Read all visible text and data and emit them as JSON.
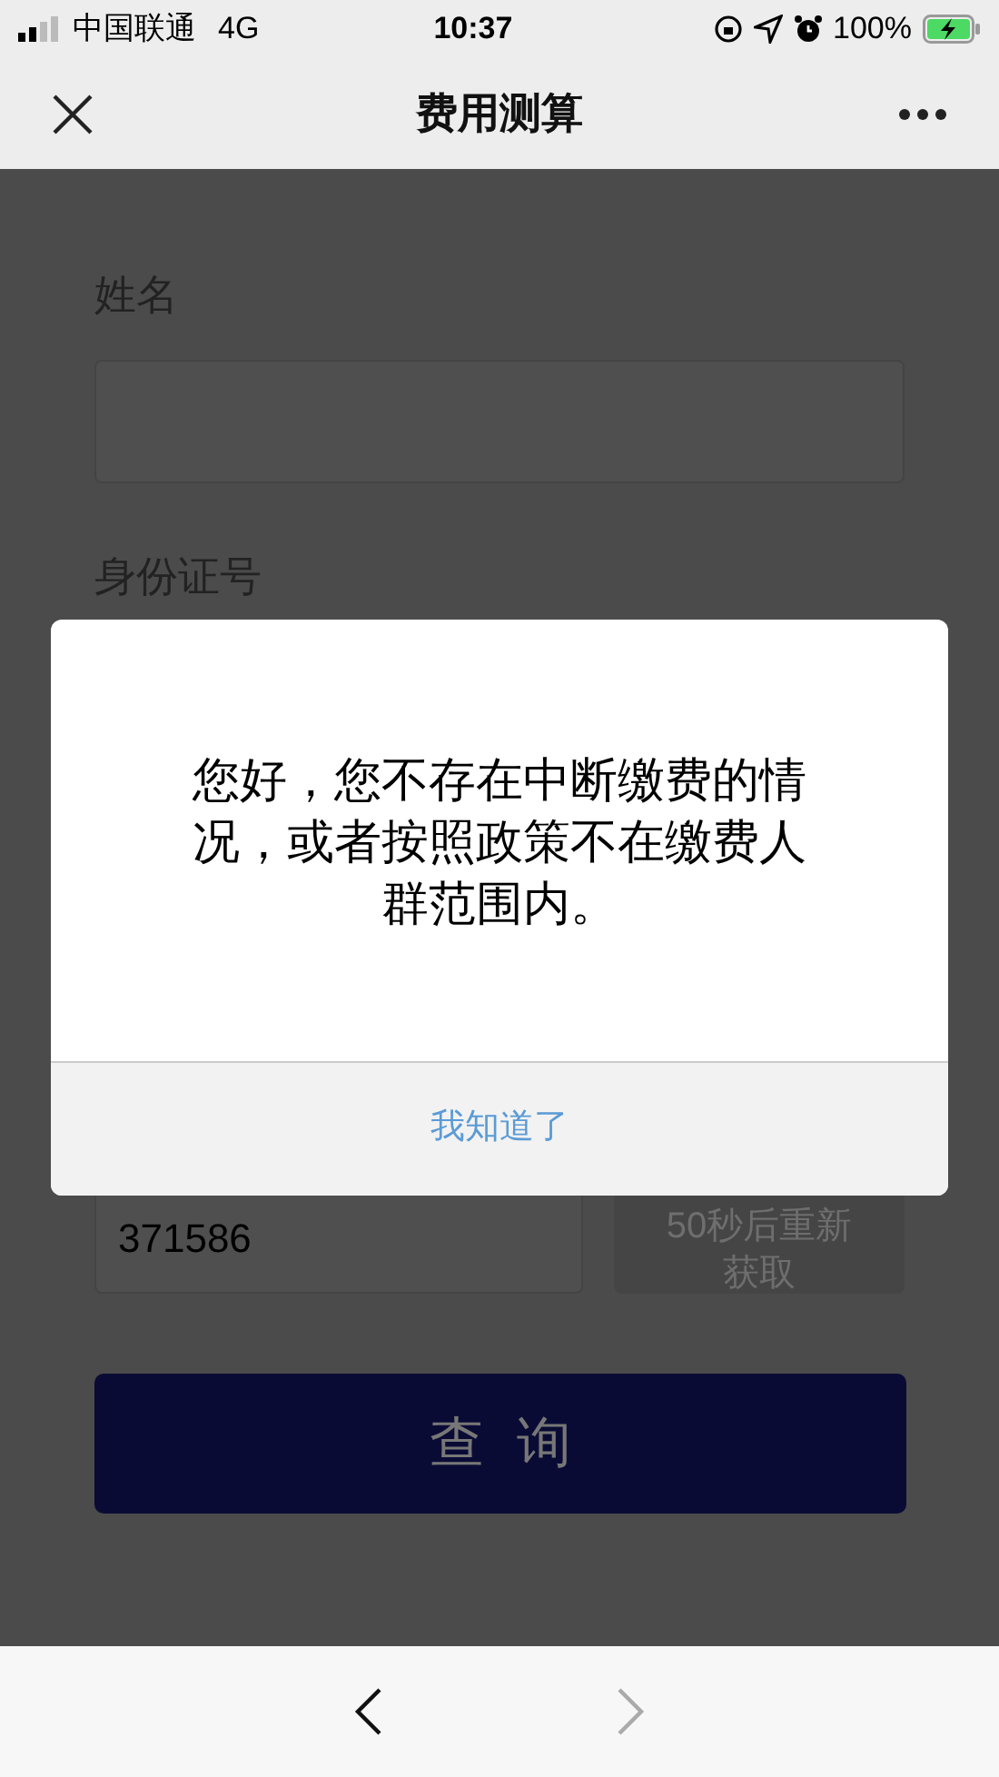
{
  "status_bar": {
    "carrier": "中国联通",
    "network": "4G",
    "time": "10:37",
    "battery": "100%"
  },
  "nav_bar": {
    "title": "费用测算"
  },
  "form": {
    "fields": [
      {
        "label": "姓名"
      },
      {
        "label": "身份证号"
      }
    ],
    "code_field": {
      "value": "371586"
    },
    "code_button": {
      "label": "50秒后重新获取",
      "disabled": true
    },
    "submit_button": {
      "label": "查询"
    }
  },
  "dialog": {
    "message": "您好，您不存在中断缴费的情况，或者按照政策不在缴费人群范围内。",
    "button": "我知道了"
  },
  "bottom_bar": {
    "back_disabled": false,
    "forward_disabled": true
  }
}
